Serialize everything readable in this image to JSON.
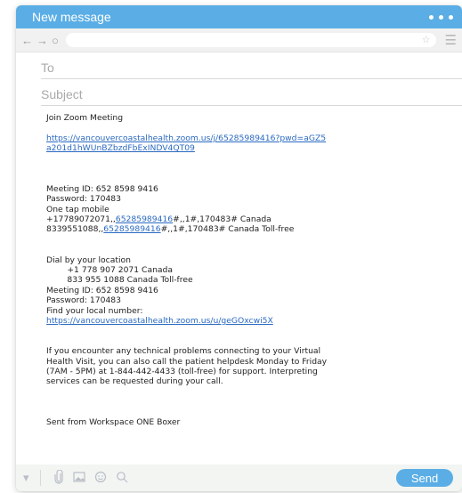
{
  "window": {
    "title": "New message"
  },
  "compose": {
    "to_placeholder": "To",
    "subject_placeholder": "Subject",
    "body": {
      "join": "Join Zoom Meeting",
      "link1_line1": "https://vancouvercoastalhealth.zoom.us/j/65285989416?pwd=aGZ5",
      "link1_line2": "a201d1hWUnBZbzdFbExINDV4QT09",
      "meeting_id": "Meeting ID: 652 8598 9416",
      "password": "Password: 170483",
      "one_tap": "One tap mobile",
      "tap1_pre": "+17789072071,,",
      "tap1_link": "65285989416",
      "tap1_post": "#,,1#,170483# Canada",
      "tap2_pre": "8339551088,,",
      "tap2_link": "65285989416",
      "tap2_post": "#,,1#,170483# Canada Toll-free",
      "dial": "Dial by your location",
      "num1": "        +1 778 907 2071 Canada",
      "num2": "        833 955 1088 Canada Toll-free",
      "meeting_id2": "Meeting ID: 652 8598 9416",
      "password2": "Password: 170483",
      "find": "Find your local number:",
      "link2": "https://vancouvercoastalhealth.zoom.us/u/geGOxcwi5X",
      "help1": "If you encounter any technical problems connecting to your Virtual",
      "help2": "Health Visit, you can also call the patient helpdesk Monday to Friday",
      "help3": "(7AM - 5PM) at 1-844-442-4433 (toll-free) for support. Interpreting",
      "help4": "services can be requested during your call.",
      "signature": "Sent from Workspace ONE Boxer"
    }
  },
  "toolbar": {
    "send_label": "Send"
  },
  "colors": {
    "accent": "#5aaee5",
    "link": "#2a6ac1"
  }
}
